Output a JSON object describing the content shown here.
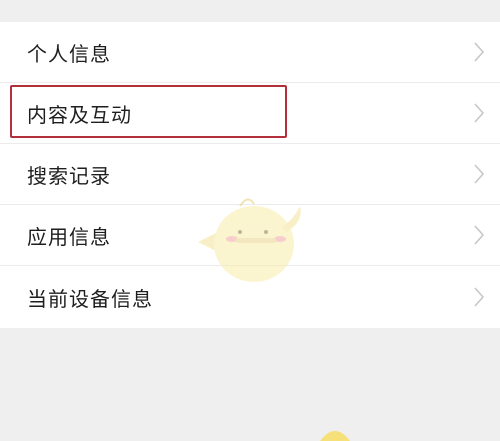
{
  "menu": {
    "items": [
      {
        "label": "个人信息"
      },
      {
        "label": "内容及互动"
      },
      {
        "label": "搜索记录"
      },
      {
        "label": "应用信息"
      },
      {
        "label": "当前设备信息"
      }
    ]
  },
  "highlight": {
    "target": "内容及互动",
    "color": "#b3303a"
  },
  "icons": {
    "chevron": "chevron-right-icon",
    "watermark": "duck-mascot-watermark"
  }
}
